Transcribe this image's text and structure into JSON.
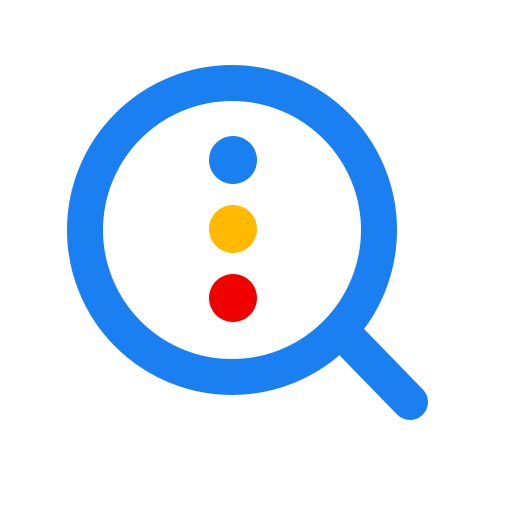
{
  "app_icon": {
    "icon_name": "magnifier-with-dots-icon",
    "background_color": "#FFFFFF",
    "magnifier_color": "#1A7FF0",
    "dot_colors": {
      "top": "#1A7FF0",
      "middle": "#FFBA00",
      "bottom": "#F00000"
    }
  }
}
